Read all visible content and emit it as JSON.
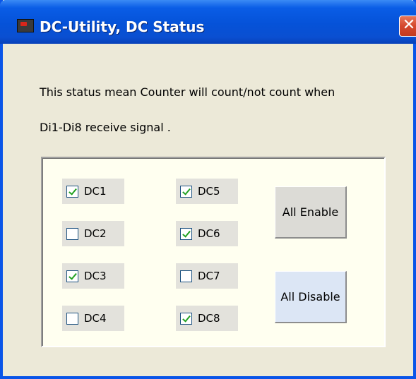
{
  "window": {
    "title": "DC-Utility, DC Status",
    "close_glyph": "✕",
    "app_icon": "dc-utility-app-icon"
  },
  "description": {
    "line1": "This status mean Counter will count/not count when",
    "line2": "Di1-Di8 receive signal ."
  },
  "channels": [
    {
      "label": "DC1",
      "checked": true
    },
    {
      "label": "DC2",
      "checked": false
    },
    {
      "label": "DC3",
      "checked": true
    },
    {
      "label": "DC4",
      "checked": false
    },
    {
      "label": "DC5",
      "checked": true
    },
    {
      "label": "DC6",
      "checked": true
    },
    {
      "label": "DC7",
      "checked": false
    },
    {
      "label": "DC8",
      "checked": true
    }
  ],
  "buttons": {
    "all_enable": "All Enable",
    "all_disable": "All Disable"
  },
  "colors": {
    "titlebar": "#0552D8",
    "window_bg": "#ECE9D8",
    "group_bg": "#FFFFF0",
    "close_button": "#D4472D",
    "check_mark": "#21A121"
  }
}
